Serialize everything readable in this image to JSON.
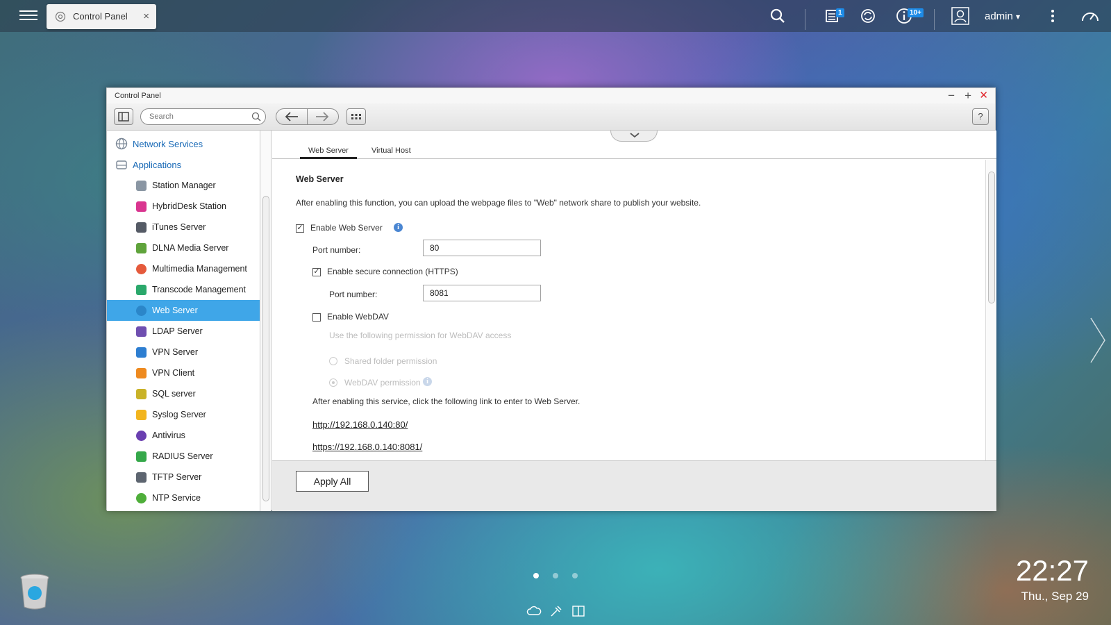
{
  "topbar": {
    "tab_label": "Control Panel",
    "tab_close": "×",
    "notification_badge": "1",
    "info_badge": "10+",
    "user_name": "admin",
    "user_caret": "▾"
  },
  "window": {
    "title": "Control Panel",
    "minimize": "−",
    "maximize": "+",
    "close": "✕",
    "help": "?",
    "search_placeholder": "Search"
  },
  "sidebar": {
    "categories": [
      {
        "label": "Network Services"
      },
      {
        "label": "Applications"
      }
    ],
    "items": [
      {
        "label": "Station Manager",
        "color": "#8a96a3"
      },
      {
        "label": "HybridDesk Station",
        "color": "#d9358f"
      },
      {
        "label": "iTunes Server",
        "color": "#555b66"
      },
      {
        "label": "DLNA Media Server",
        "color": "#5fa33b"
      },
      {
        "label": "Multimedia Management",
        "color": "#e55a3c"
      },
      {
        "label": "Transcode Management",
        "color": "#2aa86b"
      },
      {
        "label": "Web Server",
        "color": "#3fa6e8",
        "active": true
      },
      {
        "label": "LDAP Server",
        "color": "#6f4fb0"
      },
      {
        "label": "VPN Server",
        "color": "#2d7ed1"
      },
      {
        "label": "VPN Client",
        "color": "#ee8a1f"
      },
      {
        "label": "SQL server",
        "color": "#c9b227"
      },
      {
        "label": "Syslog Server",
        "color": "#f2b51e"
      },
      {
        "label": "Antivirus",
        "color": "#6a3fb0"
      },
      {
        "label": "RADIUS Server",
        "color": "#35a84a"
      },
      {
        "label": "TFTP Server",
        "color": "#5d6570"
      },
      {
        "label": "NTP Service",
        "color": "#4fae3a"
      }
    ]
  },
  "content": {
    "tabs": [
      "Web Server",
      "Virtual Host"
    ],
    "section_title": "Web Server",
    "description": "After enabling this function, you can upload the webpage files to \"Web\" network share to publish your website.",
    "enable_web_server": {
      "label": "Enable Web Server",
      "checked": true
    },
    "port_label": "Port number:",
    "port_value": "80",
    "enable_https": {
      "label": "Enable secure connection (HTTPS)",
      "checked": true
    },
    "https_port_label": "Port number:",
    "https_port_value": "8081",
    "enable_webdav": {
      "label": "Enable WebDAV",
      "checked": false
    },
    "webdav_hint": "Use the following permission for WebDAV access",
    "webdav_options": [
      "Shared folder permission",
      "WebDAV permission"
    ],
    "link_intro": "After enabling this service, click the following link to enter to Web Server.",
    "links": [
      "http://192.168.0.140:80/",
      "https://192.168.0.140:8081/"
    ],
    "apply_label": "Apply All"
  },
  "desktop": {
    "time": "22:27",
    "date": "Thu., Sep 29"
  },
  "colors": {
    "accent": "#3fa6e8",
    "link_blue": "#1869b6",
    "close_red": "#e0252b"
  }
}
